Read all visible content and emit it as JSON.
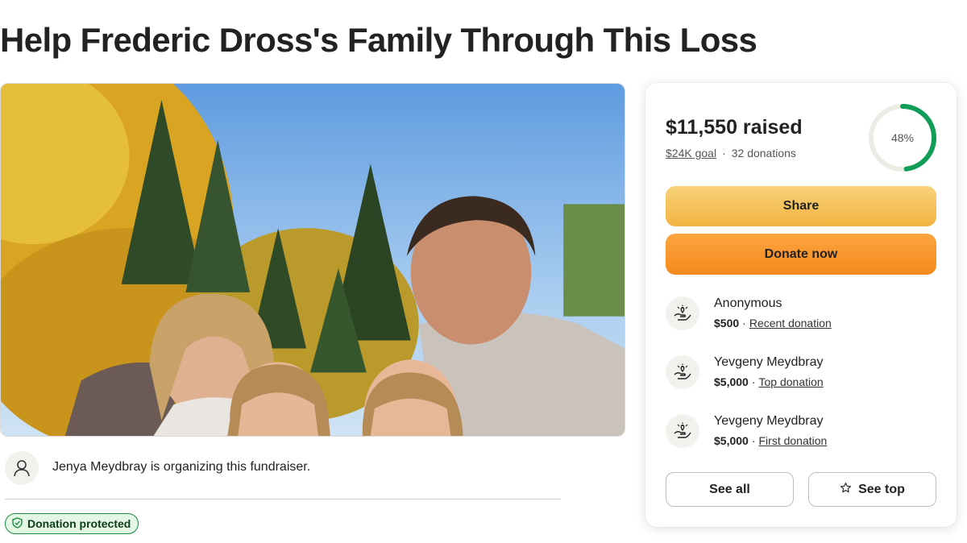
{
  "page": {
    "title": "Help Frederic Dross's Family Through This Loss"
  },
  "organizer": {
    "text": "Jenya Meydbray is organizing this fundraiser."
  },
  "badge": {
    "label": "Donation protected"
  },
  "panel": {
    "raised": "$11,550 raised",
    "goal": "$24K goal",
    "separator": "·",
    "donations_count": "32 donations",
    "progress_percent": 48,
    "progress_label": "48%",
    "share_label": "Share",
    "donate_label": "Donate now",
    "recent_donations": [
      {
        "name": "Anonymous",
        "amount": "$500",
        "tag": "Recent donation"
      },
      {
        "name": "Yevgeny Meydbray",
        "amount": "$5,000",
        "tag": "Top donation"
      },
      {
        "name": "Yevgeny Meydbray",
        "amount": "$5,000",
        "tag": "First donation"
      }
    ],
    "see_all_label": "See all",
    "see_top_label": "See top"
  },
  "colors": {
    "progress_green": "#0f9d58",
    "progress_track": "#ecebe4",
    "share_yellow": "#f3b33f",
    "donate_orange": "#f68a1e",
    "badge_green": "#1a8a3c"
  },
  "icons": {
    "organizer": "person-icon",
    "donor": "heart-hand-icon",
    "badge": "shield-check-icon",
    "see_top": "star-icon"
  }
}
